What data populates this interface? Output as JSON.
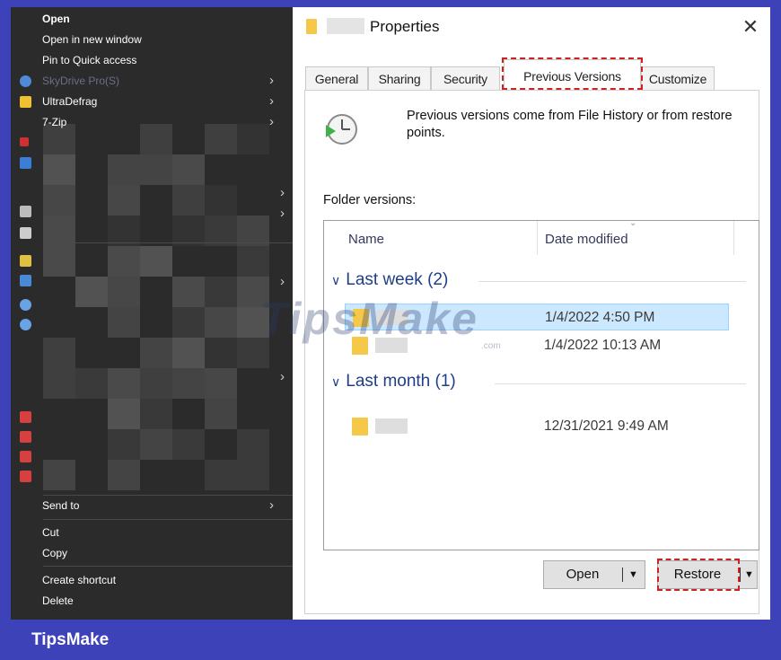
{
  "context_menu": {
    "items": [
      {
        "label": "Open"
      },
      {
        "label": "Open in new window"
      },
      {
        "label": "Pin to Quick access"
      },
      {
        "label": "SkyDrive Pro(S)",
        "disabled": true,
        "submenu": true
      },
      {
        "label": "UltraDefrag",
        "submenu": true
      },
      {
        "label": "7-Zip",
        "submenu": true
      }
    ],
    "bottom_items": [
      {
        "label": "Send to",
        "submenu": true
      },
      {
        "label": "Cut"
      },
      {
        "label": "Copy"
      },
      {
        "label": "Create shortcut"
      },
      {
        "label": "Delete"
      }
    ],
    "icon_colors": [
      "#4f8ad8",
      "#f0c030",
      "#d03030",
      "#3a7fd5",
      "#bbbbbb",
      "#cccccc",
      "#e0c040",
      "#4a88d8",
      "#6aa2e6",
      "#6aa2e6",
      "#d84040",
      "#d84040",
      "#d84040",
      "#d84040"
    ]
  },
  "dialog": {
    "title": "Properties",
    "close_glyph": "✕",
    "tabs": [
      {
        "label": "General",
        "active": false
      },
      {
        "label": "Sharing",
        "active": false
      },
      {
        "label": "Security",
        "active": false
      },
      {
        "label": "Previous Versions",
        "active": true
      },
      {
        "label": "Customize",
        "active": false
      }
    ],
    "description": "Previous versions come from File History or from restore points.",
    "folder_versions_label": "Folder versions:",
    "list": {
      "columns": [
        "Name",
        "Date modified"
      ],
      "groups": [
        {
          "label": "Last week (2)",
          "rows": [
            {
              "date": "1/4/2022 4:50 PM",
              "selected": true
            },
            {
              "date": "1/4/2022 10:13 AM",
              "selected": false
            }
          ]
        },
        {
          "label": "Last month (1)",
          "rows": [
            {
              "date": "12/31/2021 9:49 AM",
              "selected": false
            }
          ]
        }
      ]
    },
    "buttons": {
      "open": "Open",
      "restore": "Restore"
    },
    "icons": {
      "clock": "clock-restore-icon",
      "folder": "folder-icon",
      "dropdown": "dropdown-arrow-icon"
    }
  },
  "watermark": {
    "text": "TipsMake",
    "suffix": ".com"
  },
  "banner": {
    "text": "TipsMake"
  },
  "colors": {
    "frame": "#3d42b8",
    "highlight": "#cc2222",
    "selected_row": "#cce8ff",
    "menu_bg": "#2b2b2b"
  }
}
